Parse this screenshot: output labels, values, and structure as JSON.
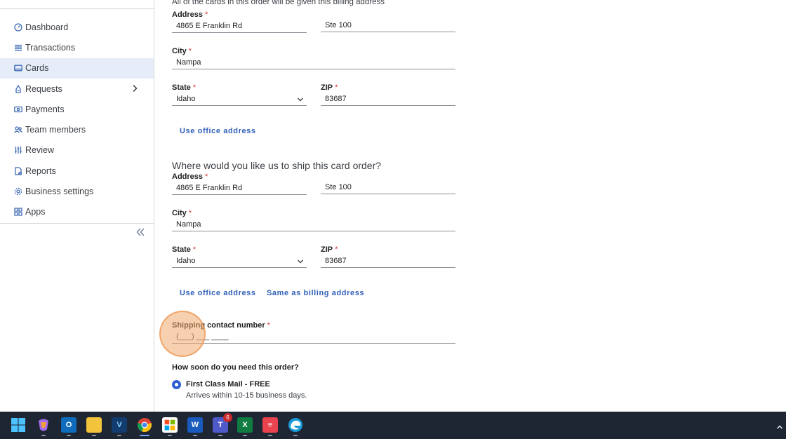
{
  "sidebar": {
    "items": [
      {
        "label": "Dashboard",
        "icon": "dashboard-icon"
      },
      {
        "label": "Transactions",
        "icon": "list-icon"
      },
      {
        "label": "Cards",
        "icon": "card-icon",
        "active": true
      },
      {
        "label": "Requests",
        "icon": "requests-icon"
      },
      {
        "label": "Payments",
        "icon": "payments-icon"
      },
      {
        "label": "Team members",
        "icon": "team-icon"
      },
      {
        "label": "Review",
        "icon": "sliders-icon"
      },
      {
        "label": "Reports",
        "icon": "report-icon"
      },
      {
        "label": "Business settings",
        "icon": "gear-icon"
      },
      {
        "label": "Apps",
        "icon": "apps-icon"
      }
    ]
  },
  "billing": {
    "intro": "All of the cards in this order will be given this billing address",
    "address_label": "Address",
    "address1": "4865 E Franklin Rd",
    "address2": "Ste 100",
    "city_label": "City",
    "city": "Nampa",
    "state_label": "State",
    "state": "Idaho",
    "zip_label": "ZIP",
    "zip": "83687",
    "use_office_link": "Use office address"
  },
  "shipping": {
    "heading": "Where would you like us to ship this card order?",
    "address_label": "Address",
    "address1": "4865 E Franklin Rd",
    "address2": "Ste 100",
    "city_label": "City",
    "city": "Nampa",
    "state_label": "State",
    "state": "Idaho",
    "zip_label": "ZIP",
    "zip": "83687",
    "use_office_link": "Use office address",
    "same_as_billing_link": "Same as billing address",
    "contact_label": "Shipping contact number",
    "contact_placeholder": "(___) ___ ____"
  },
  "delivery": {
    "question": "How soon do you need this order?",
    "option_label": "First Class Mail - FREE",
    "option_detail": "Arrives within 10-15 business days."
  },
  "required_mark": "*",
  "taskbar": {
    "teams_badge": "6"
  },
  "colors": {
    "accent": "#2f5fb8",
    "required": "#d6332f",
    "active_nav_bg": "#e6edf8",
    "taskbar_bg": "#1e2634"
  }
}
